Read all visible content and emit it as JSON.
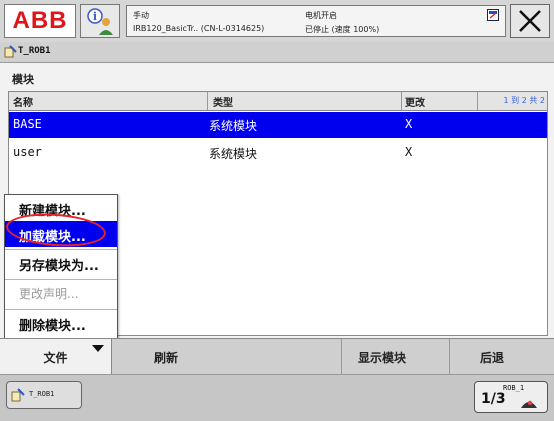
{
  "header": {
    "logo": "ABB",
    "mode": "手动",
    "system": "IRB120_BasicTr.. (CN-L-0314625)",
    "motor_state": "电机开启",
    "run_state": "已停止 (速度 100%)"
  },
  "taskbar": {
    "active_task": "T_ROB1"
  },
  "module_view": {
    "section_title": "模块",
    "columns": [
      "名称",
      "类型",
      "更改"
    ],
    "pager": "1 到 2 共 2",
    "rows": [
      {
        "name": "BASE",
        "type": "系统模块",
        "changed": "X",
        "selected": true
      },
      {
        "name": "user",
        "type": "系统模块",
        "changed": "X",
        "selected": false
      }
    ]
  },
  "file_menu": {
    "items": [
      {
        "label": "新建模块...",
        "enabled": true
      },
      {
        "label": "加载模块...",
        "enabled": true,
        "highlighted": true
      },
      {
        "label": "另存模块为...",
        "enabled": true
      },
      {
        "label": "更改声明...",
        "enabled": false
      },
      {
        "label": "删除模块...",
        "enabled": true
      }
    ]
  },
  "commandbar": {
    "file": "文件",
    "refresh": "刷新",
    "show_module": "显示模块",
    "back": "后退"
  },
  "bottombar": {
    "task_button": "T_ROB1",
    "quickset_rob": "ROB_1",
    "quickset_speed": "1/3"
  },
  "colors": {
    "selection": "#0000ee",
    "abb_red": "#e1141c",
    "annotation": "#e8232a"
  },
  "icons": [
    "abb-logo",
    "info-user-icon",
    "close-icon",
    "program-icon",
    "dropdown-triangle-icon",
    "quickset-icon"
  ]
}
